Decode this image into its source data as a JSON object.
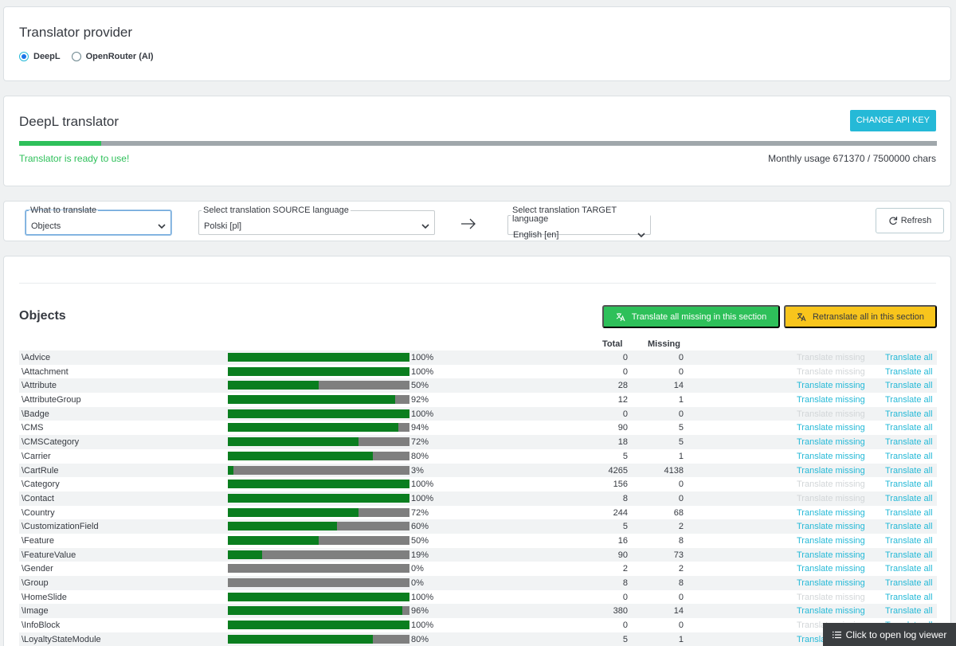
{
  "provider": {
    "title": "Translator provider",
    "options": [
      {
        "label": "DeepL",
        "selected": true
      },
      {
        "label": "OpenRouter (AI)",
        "selected": false
      }
    ]
  },
  "deepl": {
    "title": "DeepL translator",
    "change_api_key": "CHANGE API KEY",
    "status": "Translator is ready to use!",
    "usage": "Monthly usage 671370 / 7500000 chars",
    "usage_fraction": 0.0895
  },
  "selectors": {
    "what": {
      "legend": "What to translate",
      "value": "Objects"
    },
    "source": {
      "legend": "Select translation SOURCE language",
      "value": "Polski [pl]"
    },
    "target": {
      "legend": "Select translation TARGET language",
      "value": "English [en]"
    },
    "refresh": "Refresh"
  },
  "section": {
    "title": "Objects",
    "translate_missing_btn": "Translate all missing in this section",
    "retranslate_btn": "Retranslate all in this section",
    "col_total": "Total",
    "col_missing": "Missing",
    "row_translate_missing": "Translate missing",
    "row_translate_all": "Translate all",
    "rows": [
      {
        "name": "\\Advice",
        "pct": 100,
        "total": "0",
        "missing": "0"
      },
      {
        "name": "\\Attachment",
        "pct": 100,
        "total": "0",
        "missing": "0"
      },
      {
        "name": "\\Attribute",
        "pct": 50,
        "total": "28",
        "missing": "14"
      },
      {
        "name": "\\AttributeGroup",
        "pct": 92,
        "total": "12",
        "missing": "1"
      },
      {
        "name": "\\Badge",
        "pct": 100,
        "total": "0",
        "missing": "0"
      },
      {
        "name": "\\CMS",
        "pct": 94,
        "total": "90",
        "missing": "5"
      },
      {
        "name": "\\CMSCategory",
        "pct": 72,
        "total": "18",
        "missing": "5"
      },
      {
        "name": "\\Carrier",
        "pct": 80,
        "total": "5",
        "missing": "1"
      },
      {
        "name": "\\CartRule",
        "pct": 3,
        "total": "4265",
        "missing": "4138"
      },
      {
        "name": "\\Category",
        "pct": 100,
        "total": "156",
        "missing": "0"
      },
      {
        "name": "\\Contact",
        "pct": 100,
        "total": "8",
        "missing": "0"
      },
      {
        "name": "\\Country",
        "pct": 72,
        "total": "244",
        "missing": "68"
      },
      {
        "name": "\\CustomizationField",
        "pct": 60,
        "total": "5",
        "missing": "2"
      },
      {
        "name": "\\Feature",
        "pct": 50,
        "total": "16",
        "missing": "8"
      },
      {
        "name": "\\FeatureValue",
        "pct": 19,
        "total": "90",
        "missing": "73"
      },
      {
        "name": "\\Gender",
        "pct": 0,
        "total": "2",
        "missing": "2"
      },
      {
        "name": "\\Group",
        "pct": 0,
        "total": "8",
        "missing": "8"
      },
      {
        "name": "\\HomeSlide",
        "pct": 100,
        "total": "0",
        "missing": "0"
      },
      {
        "name": "\\Image",
        "pct": 96,
        "total": "380",
        "missing": "14"
      },
      {
        "name": "\\InfoBlock",
        "pct": 100,
        "total": "0",
        "missing": "0"
      },
      {
        "name": "\\LoyaltyStateModule",
        "pct": 80,
        "total": "5",
        "missing": "1"
      }
    ]
  },
  "log_viewer": "Click to open log viewer",
  "colors": {
    "accent": "#25b9d7",
    "success": "#2ec05a",
    "warning": "#f8c51c",
    "bar_fill": "#0a7e1f",
    "bar_bg": "#7f7f7f"
  }
}
